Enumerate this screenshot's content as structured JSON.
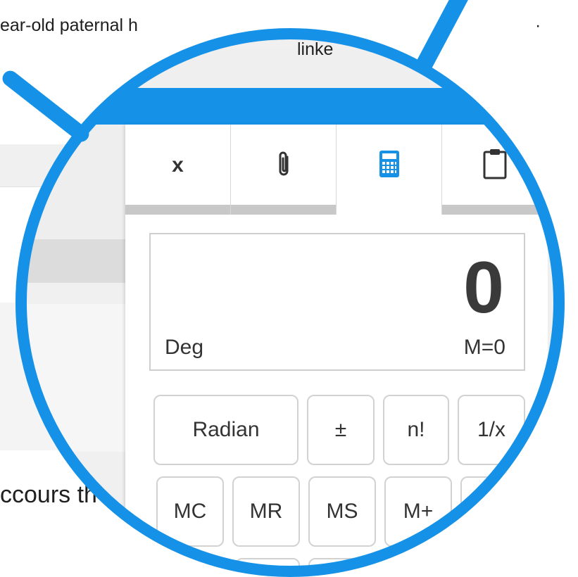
{
  "background": {
    "top_text": "ear-old paternal h",
    "top_text_right": "linke",
    "top_dot": "·",
    "bottom_text": "ccours th"
  },
  "calculator": {
    "tabs": [
      {
        "label": "x",
        "icon": "close-icon"
      },
      {
        "label": "",
        "icon": "paperclip-icon"
      },
      {
        "label": "",
        "icon": "calculator-icon",
        "active": true
      },
      {
        "label": "",
        "icon": "clipboard-icon"
      }
    ],
    "display": {
      "value": "0",
      "angle_mode": "Deg",
      "memory": "M=0"
    },
    "keys_row1": [
      "Radian",
      "±",
      "n!",
      "1/x"
    ],
    "keys_row2": [
      "MC",
      "MR",
      "MS",
      "M+"
    ]
  },
  "colors": {
    "accent": "#1592e8",
    "tab_underline": "#c8c8c8"
  }
}
